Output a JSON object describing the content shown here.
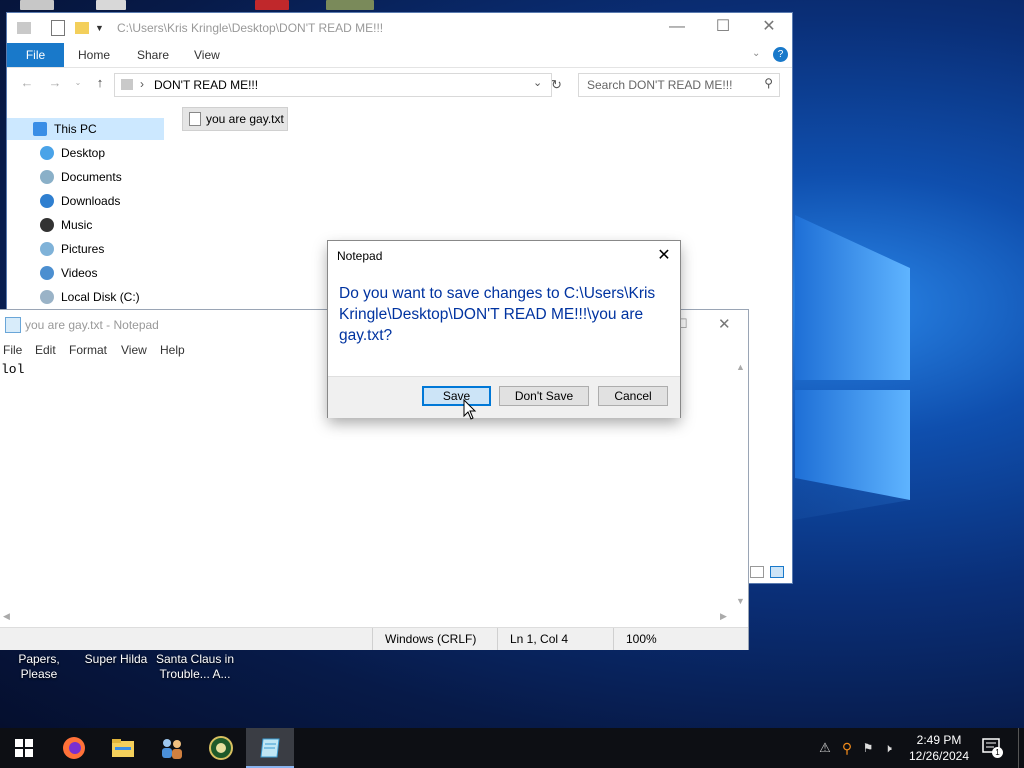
{
  "explorer": {
    "title_path": "C:\\Users\\Kris Kringle\\Desktop\\DON'T READ ME!!!",
    "ribbon": {
      "file": "File",
      "home": "Home",
      "share": "Share",
      "view": "View"
    },
    "address": "DON'T READ ME!!!",
    "search_placeholder": "Search DON'T READ ME!!!",
    "nav": [
      {
        "label": "This PC"
      },
      {
        "label": "Desktop"
      },
      {
        "label": "Documents"
      },
      {
        "label": "Downloads"
      },
      {
        "label": "Music"
      },
      {
        "label": "Pictures"
      },
      {
        "label": "Videos"
      },
      {
        "label": "Local Disk (C:)"
      }
    ],
    "file_name": "you are gay.txt"
  },
  "notepad": {
    "title": "you are gay.txt - Notepad",
    "menus": [
      "File",
      "Edit",
      "Format",
      "View",
      "Help"
    ],
    "content": "lol",
    "status": {
      "line_ending": "Windows (CRLF)",
      "position": "Ln 1, Col 4",
      "zoom": "100%"
    }
  },
  "dialog": {
    "title": "Notepad",
    "message": "Do you want to save changes to C:\\Users\\Kris Kringle\\Desktop\\DON'T READ ME!!!\\you are gay.txt?",
    "buttons": {
      "save": "Save",
      "dont_save": "Don't Save",
      "cancel": "Cancel"
    }
  },
  "desktop_icons": [
    {
      "label": "Papers, Please"
    },
    {
      "label": "Super Hilda"
    },
    {
      "label": "Santa Claus in Trouble... A..."
    }
  ],
  "taskbar": {
    "apps": [
      "windows-start-icon",
      "firefox-icon",
      "file-explorer-icon",
      "people-icon",
      "game-icon",
      "notepad-icon"
    ],
    "clock": {
      "time": "2:49 PM",
      "date": "12/26/2024"
    },
    "notification_count": "1"
  },
  "colors": {
    "accent": "#1979ca",
    "dialog_text": "#0033a0",
    "taskbar": "#0d0f14"
  }
}
